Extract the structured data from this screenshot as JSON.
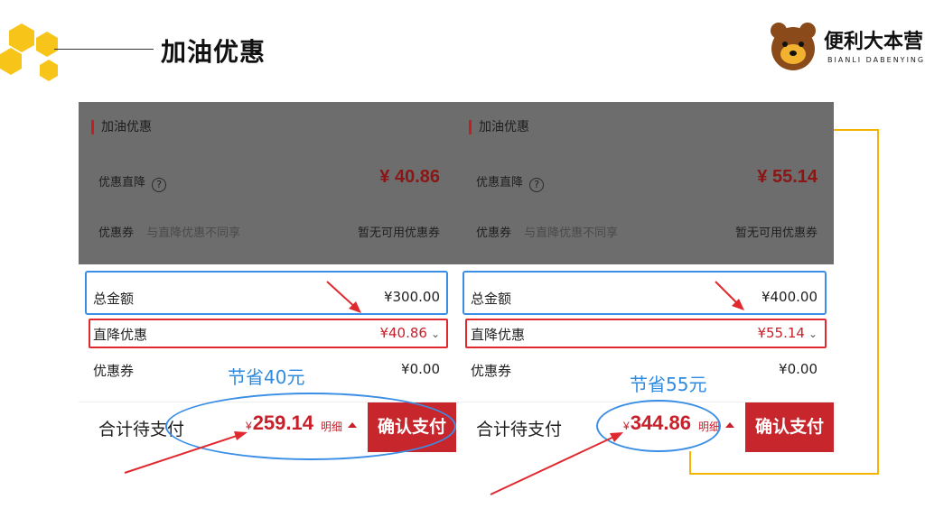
{
  "slide": {
    "title": "加油优惠",
    "logo_text": "便利大本营",
    "logo_sub": "BIANLI DABENYING"
  },
  "panels": [
    {
      "section_title": "加油优惠",
      "direct_discount_label": "优惠直降",
      "question_icon": "?",
      "direct_discount_amount": "¥ 40.86",
      "coupon_label": "优惠券",
      "coupon_note": "与直降优惠不同享",
      "coupon_status": "暂无可用优惠券",
      "total_label": "总金额",
      "total_value": "¥300.00",
      "discount_label": "直降优惠",
      "discount_value": "¥40.86",
      "coupon_row_label": "优惠券",
      "coupon_row_value": "¥0.00",
      "pay_label": "合计待支付",
      "yen": "¥",
      "pay_amount": "259.14",
      "detail_label": "明细",
      "confirm_label": "确认支付",
      "save_text": "节省40元"
    },
    {
      "section_title": "加油优惠",
      "direct_discount_label": "优惠直降",
      "question_icon": "?",
      "direct_discount_amount": "¥ 55.14",
      "coupon_label": "优惠券",
      "coupon_note": "与直降优惠不同享",
      "coupon_status": "暂无可用优惠券",
      "total_label": "总金额",
      "total_value": "¥400.00",
      "discount_label": "直降优惠",
      "discount_value": "¥55.14",
      "coupon_row_label": "优惠券",
      "coupon_row_value": "¥0.00",
      "pay_label": "合计待支付",
      "yen": "¥",
      "pay_amount": "344.86",
      "detail_label": "明细",
      "confirm_label": "确认支付",
      "save_text": "节省55元"
    }
  ],
  "icons": {
    "chevron": "chevron-down-icon",
    "detail": "triangle-up-icon",
    "decor": "hexagon-icon"
  },
  "colors": {
    "accent_red": "#c8202a",
    "highlight_blue": "#3a8ee6",
    "highlight_red": "#e0292f",
    "brand_yellow": "#f5b400",
    "overlay_gray": "#6d6d6d"
  }
}
